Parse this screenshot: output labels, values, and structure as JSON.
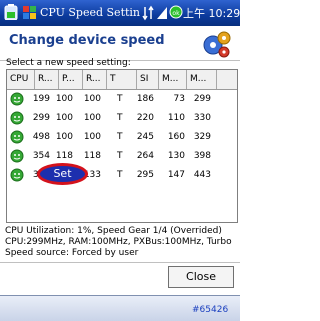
{
  "titlebar": {
    "title": "CPU Speed Settings",
    "clock": "上午 10:29"
  },
  "header": {
    "title": "Change device speed"
  },
  "subtitle": "Select a new speed setting:",
  "table": {
    "columns": [
      "CPU",
      "R...",
      "P...",
      "R...",
      "T",
      "SI",
      "M...",
      "M..."
    ],
    "rows": [
      [
        "199",
        "100",
        "100",
        "T",
        "186",
        "73",
        "299"
      ],
      [
        "299",
        "100",
        "100",
        "T",
        "220",
        "110",
        "330"
      ],
      [
        "498",
        "100",
        "100",
        "T",
        "245",
        "160",
        "329"
      ],
      [
        "354",
        "118",
        "118",
        "T",
        "264",
        "130",
        "398"
      ],
      [
        "398",
        "133",
        "133",
        "T",
        "295",
        "147",
        "443"
      ]
    ]
  },
  "set_popup": {
    "label": "Set"
  },
  "info": {
    "utilization": "CPU Utilization: 1%, Speed Gear 1/4 (Overrided)",
    "clocks": "CPU:299MHz, RAM:100MHz, PXBus:100MHz, Turbo",
    "source": "Speed source: Forced by user"
  },
  "close_label": "Close",
  "footer_id": "#65426"
}
